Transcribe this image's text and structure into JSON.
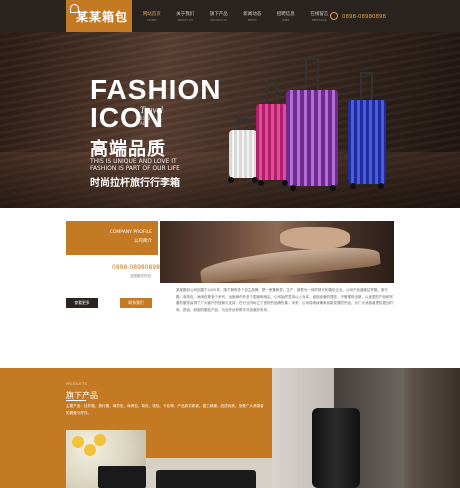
{
  "header": {
    "logo_text": "某某箱包",
    "nav": [
      {
        "cn": "网站首页",
        "en": "HOME"
      },
      {
        "cn": "关于我们",
        "en": "ABOUT US"
      },
      {
        "cn": "旗下产品",
        "en": "PRODUCTS"
      },
      {
        "cn": "新闻动态",
        "en": "NEWS"
      },
      {
        "cn": "招聘信息",
        "en": "JOBS"
      },
      {
        "cn": "在线留言",
        "en": "MESSAGE"
      }
    ],
    "phone": "0898-08980898"
  },
  "banner": {
    "line_fashion": "FASHION",
    "line_icon": "ICON",
    "travel": "Travel",
    "small1": "2018",
    "small2": "ABIY",
    "cn_title": "高端品质",
    "en_line1": "THIS IS UNIQUE AND LOVE IT",
    "en_line2": "FASHION IS PART OF OUR LIFE",
    "tagline": "时尚拉杆旅行行李箱"
  },
  "about": {
    "en_title": "COMPANY PROFILE",
    "cn_title": "公司简介",
    "phone": "0898-08980898",
    "sub": "全国服务热线",
    "more_button": "查看更多",
    "contact_button": "联系我们",
    "text": "某某箱包公司创建于2005年，旗下拥有多个自主品牌，是一家集研发、生产、销售为一体的现代化箱包企业。公司产品涵盖拉杆箱、旅行箱、商务包、休闲包等多个系列，远销海内外多个国家和地区。公司始终坚持以人为本、诚信经营的理念，不断推陈出新，以优质的产品和完善的服务赢得了广大客户的信赖与支持，在行业内树立了良好的品牌形象。未来，公司将继续秉承创新发展的宗旨，为广大消费者提供更加时尚、舒适、耐用的箱包产品，与合作伙伴携手共创美好未来。"
  },
  "products": {
    "en_title": "PRODUCTS",
    "cn_title": "旗下产品",
    "desc": "主要产品：拉杆箱、旅行箱、商务包、休闲包、背包、钱包、卡包等。产品款式新颖，做工精细，品质优良，深受广大消费者的喜爱与好评。"
  }
}
